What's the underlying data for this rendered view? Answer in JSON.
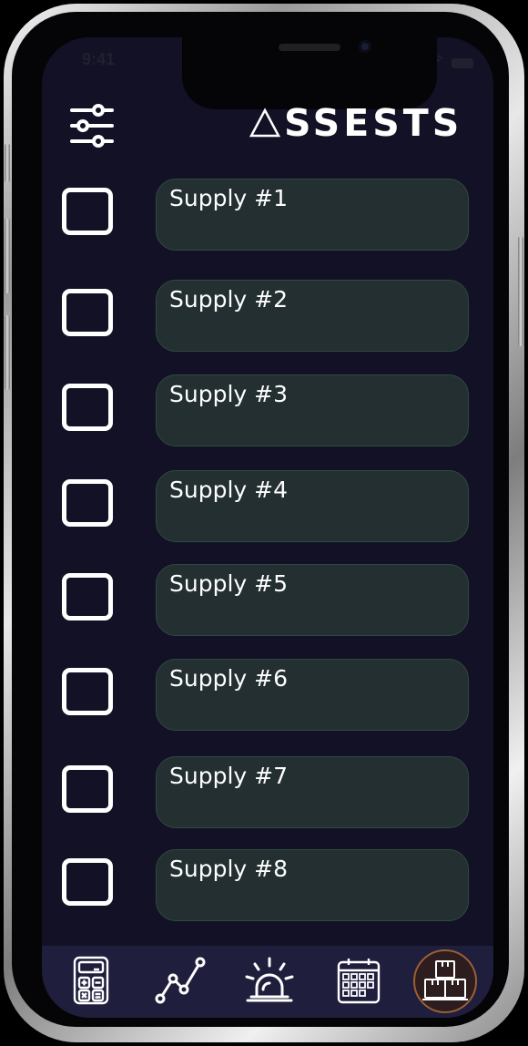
{
  "status": {
    "time": "9:41"
  },
  "header": {
    "title_rest": "SSESTS",
    "title_first": "△"
  },
  "icons": {
    "filter": "sliders-icon",
    "tabs": [
      "calculator-icon",
      "trend-line-icon",
      "siren-icon",
      "calendar-icon",
      "boxes-icon"
    ]
  },
  "supplies": [
    {
      "label": "Supply #1",
      "checked": false
    },
    {
      "label": "Supply #2",
      "checked": false
    },
    {
      "label": "Supply #3",
      "checked": false
    },
    {
      "label": "Supply #4",
      "checked": false
    },
    {
      "label": "Supply #5",
      "checked": false
    },
    {
      "label": "Supply #6",
      "checked": false
    },
    {
      "label": "Supply #7",
      "checked": false
    },
    {
      "label": "Supply #8",
      "checked": false
    }
  ],
  "tabbar": {
    "active_index": 4
  },
  "colors": {
    "background": "#131125",
    "field": "#232f30",
    "field_border": "#2f4a40",
    "tabbar": "#1f1e3d",
    "active_tab_ring": "#9b5f34"
  }
}
